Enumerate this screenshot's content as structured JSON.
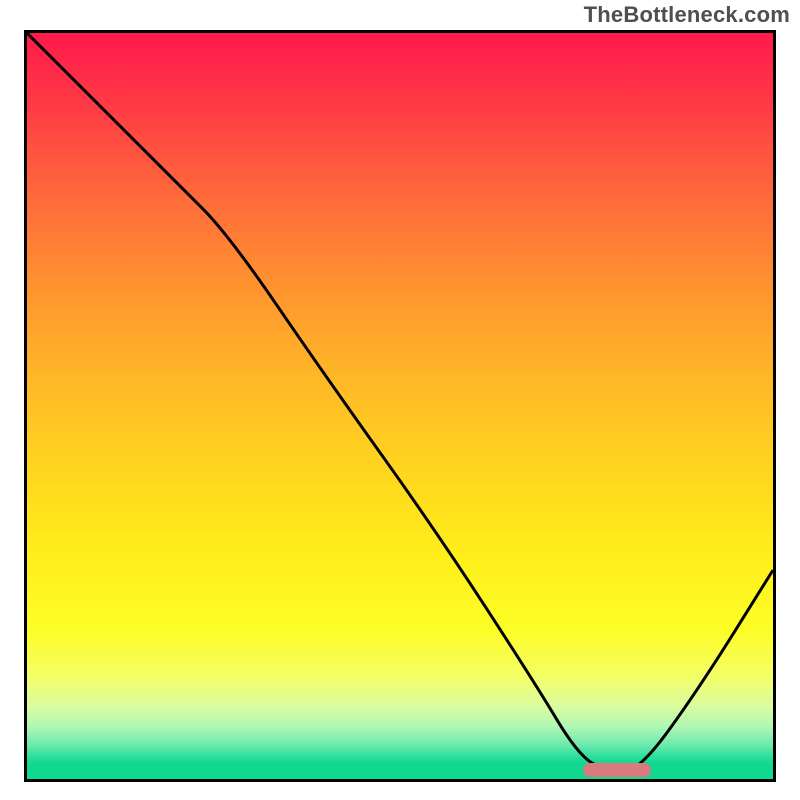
{
  "watermark": "TheBottleneck.com",
  "colors": {
    "border": "#000000",
    "curve": "#000000",
    "marker": "#d97a7f"
  },
  "chart_data": {
    "type": "line",
    "title": "",
    "xlabel": "",
    "ylabel": "",
    "xlim": [
      0,
      100
    ],
    "ylim": [
      0,
      100
    ],
    "grid": false,
    "series": [
      {
        "name": "bottleneck-curve",
        "x": [
          0,
          10,
          20,
          27,
          40,
          55,
          68,
          74,
          78,
          82,
          90,
          100
        ],
        "y": [
          100,
          90,
          80,
          73,
          54,
          33,
          13,
          3,
          1,
          1,
          12,
          28
        ]
      }
    ],
    "highlight_range_x": [
      74,
      83
    ],
    "gradient_stops": [
      {
        "pos": 0,
        "color": "#ff1a4b"
      },
      {
        "pos": 0.7,
        "color": "#ffee1a"
      },
      {
        "pos": 0.97,
        "color": "#0fd88f"
      },
      {
        "pos": 1.0,
        "color": "#0fd88f"
      }
    ]
  }
}
